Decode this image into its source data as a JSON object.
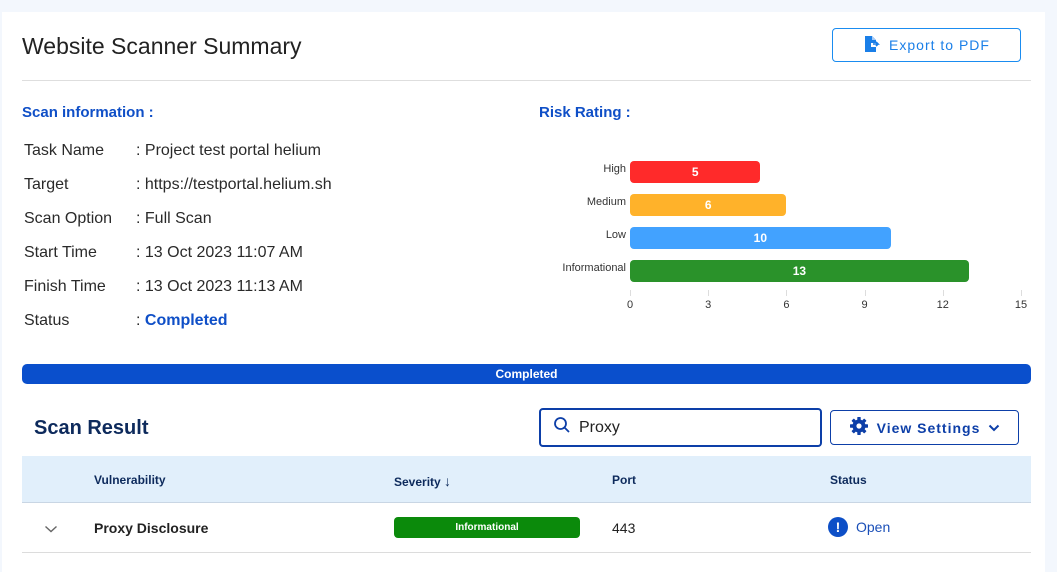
{
  "header": {
    "title": "Website Scanner Summary",
    "export_label": "Export to PDF"
  },
  "scan_info": {
    "heading": "Scan information :",
    "rows": [
      {
        "key": "Task Name",
        "value": ": Project test portal helium"
      },
      {
        "key": "Target",
        "value": ": https://testportal.helium.sh"
      },
      {
        "key": "Scan Option",
        "value": ": Full Scan"
      },
      {
        "key": "Start Time",
        "value": ": 13 Oct 2023 11:07 AM"
      },
      {
        "key": "Finish Time",
        "value": ": 13 Oct 2023 11:13 AM"
      },
      {
        "key": "Status",
        "value": ": ",
        "status": "Completed"
      }
    ]
  },
  "risk_rating": {
    "heading": "Risk Rating :"
  },
  "chart_data": {
    "type": "bar",
    "orientation": "horizontal",
    "title": "Risk Rating",
    "categories": [
      "High",
      "Medium",
      "Low",
      "Informational"
    ],
    "values": [
      5,
      6,
      10,
      13
    ],
    "colors": [
      "#ff2a2a",
      "#ffb22a",
      "#42a2ff",
      "#2a922a"
    ],
    "xlim": [
      0,
      15
    ],
    "xticks": [
      0,
      3,
      6,
      9,
      12,
      15
    ],
    "xlabel": "",
    "ylabel": "",
    "data_labels": true,
    "grid": false
  },
  "progress": {
    "label": "Completed",
    "percent": 100,
    "color": "#0a4fcc"
  },
  "scan_result": {
    "heading": "Scan Result",
    "search_value": "Proxy",
    "view_settings_label": "View Settings",
    "columns": [
      "Vulnerability",
      "Severity",
      "Port",
      "Status"
    ],
    "sort_indicator": "↓",
    "rows": [
      {
        "vulnerability": "Proxy Disclosure",
        "severity": "Informational",
        "severity_color": "#0b8a0b",
        "port": "443",
        "status": "Open"
      }
    ]
  }
}
